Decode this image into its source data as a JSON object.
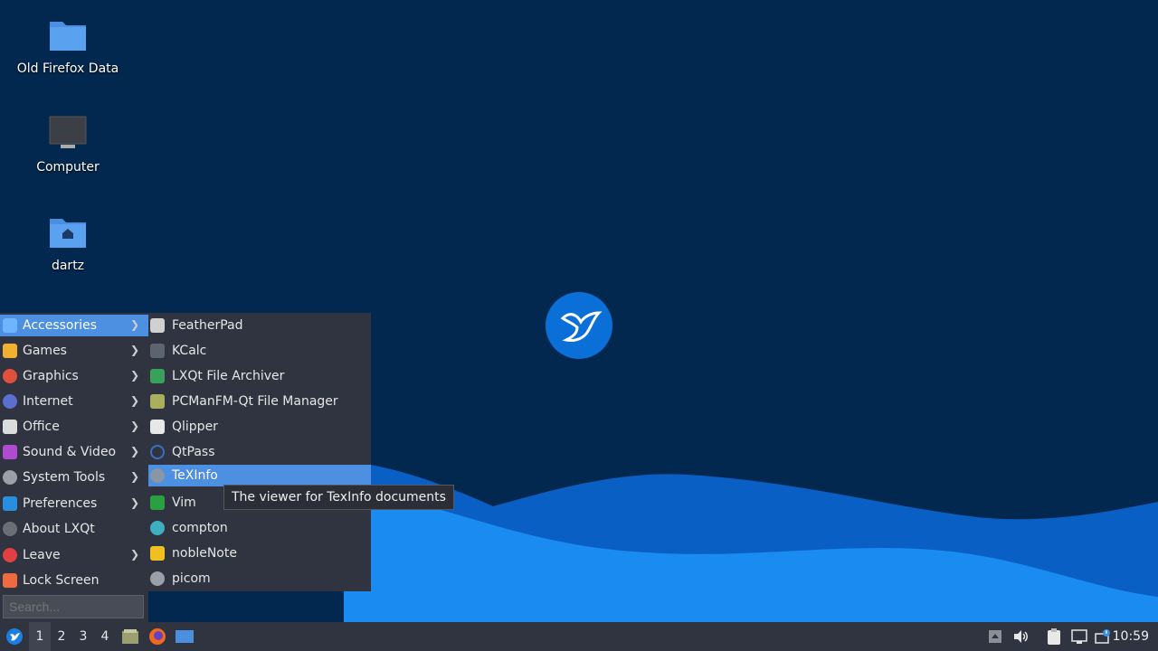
{
  "desktop": {
    "icons": [
      {
        "label": "Old Firefox Data",
        "icon": "folder-icon"
      },
      {
        "label": "Computer",
        "icon": "computer-icon"
      },
      {
        "label": "dartz",
        "icon": "home-folder-icon"
      }
    ]
  },
  "menu": {
    "categories": [
      {
        "label": "Accessories",
        "icon": "accessories-icon",
        "submenu": true,
        "active": true
      },
      {
        "label": "Games",
        "icon": "games-icon",
        "submenu": true
      },
      {
        "label": "Graphics",
        "icon": "graphics-icon",
        "submenu": true
      },
      {
        "label": "Internet",
        "icon": "internet-icon",
        "submenu": true
      },
      {
        "label": "Office",
        "icon": "office-icon",
        "submenu": true
      },
      {
        "label": "Sound & Video",
        "icon": "sound-video-icon",
        "submenu": true
      },
      {
        "label": "System Tools",
        "icon": "system-tools-icon",
        "submenu": true
      },
      {
        "label": "Preferences",
        "icon": "preferences-icon",
        "submenu": true
      },
      {
        "label": "About LXQt",
        "icon": "info-icon",
        "submenu": false
      },
      {
        "label": "Leave",
        "icon": "power-icon",
        "submenu": true
      },
      {
        "label": "Lock Screen",
        "icon": "lock-icon",
        "submenu": false
      }
    ],
    "search_placeholder": "Search...",
    "accessories": [
      {
        "label": "FeatherPad",
        "icon": "featherpad-icon"
      },
      {
        "label": "KCalc",
        "icon": "calculator-icon"
      },
      {
        "label": "LXQt File Archiver",
        "icon": "archive-icon"
      },
      {
        "label": "PCManFM-Qt File Manager",
        "icon": "file-manager-icon"
      },
      {
        "label": "Qlipper",
        "icon": "clipboard-icon"
      },
      {
        "label": "QtPass",
        "icon": "password-icon"
      },
      {
        "label": "TeXInfo",
        "icon": "texinfo-icon",
        "active": true
      },
      {
        "label": "Vim",
        "icon": "vim-icon"
      },
      {
        "label": "compton",
        "icon": "compton-icon"
      },
      {
        "label": "nobleNote",
        "icon": "note-icon"
      },
      {
        "label": "picom",
        "icon": "picom-icon"
      }
    ],
    "tooltip": "The viewer for TexInfo documents"
  },
  "taskbar": {
    "workspaces": [
      "1",
      "2",
      "3",
      "4"
    ],
    "active_workspace": "1",
    "launchers": [
      "file-manager-icon",
      "firefox-icon",
      "show-desktop-icon"
    ],
    "tray": [
      "tray-expand-icon",
      "volume-icon",
      "clipboard-icon",
      "network-icon",
      "update-notifier-icon"
    ],
    "clock": "10:59"
  },
  "colors": {
    "desktop_bg": "#03284f",
    "wave_light": "#1a8bf0",
    "wave_dark": "#0a5fc4",
    "menu_bg": "#2f3440",
    "highlight": "#4d8fe0"
  }
}
